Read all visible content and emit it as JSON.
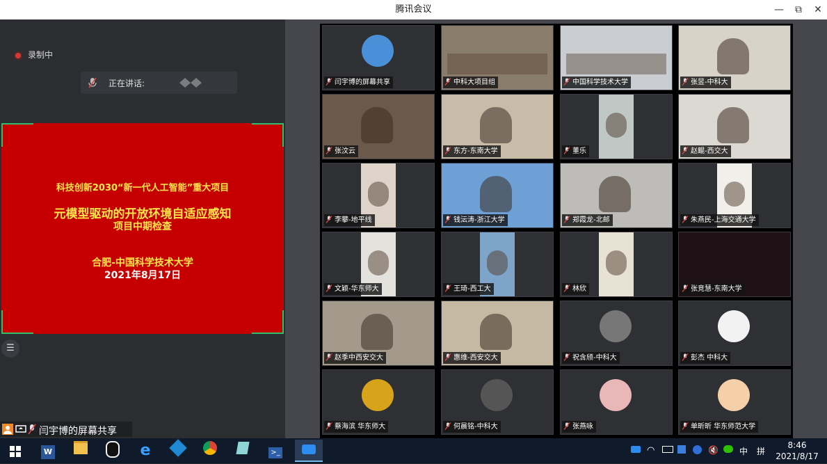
{
  "window": {
    "title": "腾讯会议",
    "minimize": "—",
    "restore": "⧉",
    "close": "✕"
  },
  "recording": {
    "label": "录制中"
  },
  "speaking": {
    "label": "正在讲话:"
  },
  "slide": {
    "line1": "科技创新2030“新一代人工智能”重大项目",
    "line2": "元模型驱动的开放环境自适应感知",
    "line3": "项目中期检查",
    "line4": "合肥-中国科学技术大学",
    "line5": "2021年8月17日"
  },
  "share": {
    "label": "闫宇博的屏幕共享"
  },
  "tiles": [
    {
      "name": "闫宇博的屏幕共享",
      "kind": "avatar",
      "color": "#4a90d9"
    },
    {
      "name": "中科大项目组",
      "kind": "room",
      "color": "#8a7c6a"
    },
    {
      "name": "中国科学技术大学",
      "kind": "room",
      "color": "#c9cdd2"
    },
    {
      "name": "张昱-中科大",
      "kind": "video",
      "color": "#d8d3c8"
    },
    {
      "name": "张汶云",
      "kind": "video",
      "color": "#6b5a4b"
    },
    {
      "name": "东方-东南大学",
      "kind": "video",
      "color": "#c8bba8"
    },
    {
      "name": "董乐",
      "kind": "narrow",
      "color": "#bfc8c4"
    },
    {
      "name": "赵鲲-西交大",
      "kind": "video",
      "color": "#dcd8d2"
    },
    {
      "name": "李攀-地平线",
      "kind": "narrow",
      "color": "#ddd3c9"
    },
    {
      "name": "钱沄涛-浙江大学",
      "kind": "video",
      "color": "#6ea0d6"
    },
    {
      "name": "郑霞龙-北邮",
      "kind": "video",
      "color": "#bdbcb8"
    },
    {
      "name": "朱燕民-上海交通大学",
      "kind": "narrow",
      "color": "#f0efe9"
    },
    {
      "name": "文颖-华东师大",
      "kind": "narrow",
      "color": "#e4e2dc"
    },
    {
      "name": "王琦-西工大",
      "kind": "narrow",
      "color": "#7fa4c9"
    },
    {
      "name": "林欣",
      "kind": "narrow",
      "color": "#e8e2d4"
    },
    {
      "name": "张竞慧-东南大学",
      "kind": "dark",
      "color": "#1e1216"
    },
    {
      "name": "赵季中西安交大",
      "kind": "video",
      "color": "#a49a8c"
    },
    {
      "name": "惠维-西安交大",
      "kind": "video",
      "color": "#c6b9a4"
    },
    {
      "name": "祝含颀-中科大",
      "kind": "avatar",
      "color": "#777777"
    },
    {
      "name": "彭杰 中科大",
      "kind": "avatar",
      "color": "#f2f2f2"
    },
    {
      "name": "蔡海滨 华东师大",
      "kind": "avatar",
      "color": "#d9a21b"
    },
    {
      "name": "何晨铭-中科大",
      "kind": "avatar",
      "color": "#555555"
    },
    {
      "name": "张燕咏",
      "kind": "avatar",
      "color": "#e9b7b7"
    },
    {
      "name": "单昕昕 华东师范大学",
      "kind": "avatar",
      "color": "#f5cfa8"
    }
  ],
  "taskbar": {
    "tray_lang": "中",
    "tray_ime": "拼",
    "time": "8:46",
    "date": "2021/8/17"
  },
  "colors": {
    "accent": "#2fbe6a",
    "slide_bg": "#c60000",
    "slide_text": "#ffe64a",
    "slide_text_alt": "#ffffff"
  }
}
